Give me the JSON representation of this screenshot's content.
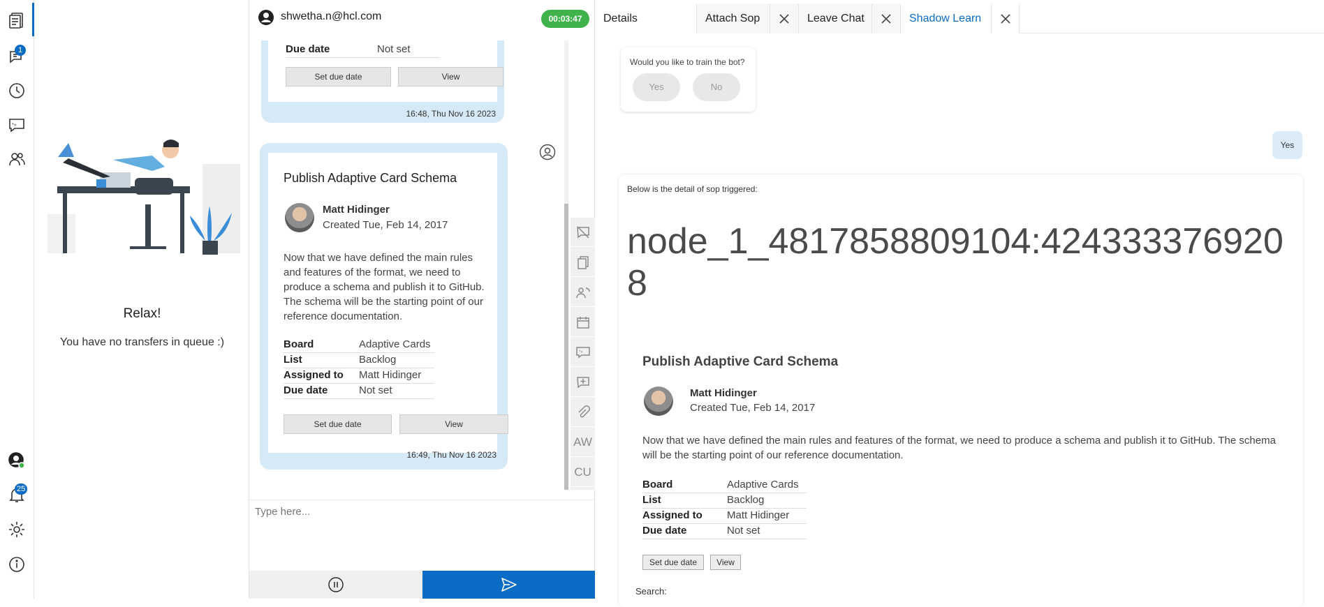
{
  "rail": {
    "icons": [
      "queue-icon",
      "chat-icon",
      "history-icon",
      "canned-response-icon",
      "contacts-icon"
    ],
    "chat_badge": "1",
    "notifications_badge": "25",
    "bottom_icons": [
      "user-status-icon",
      "bell-icon",
      "gear-icon",
      "info-icon"
    ],
    "accent": "#0b6cc5"
  },
  "queue": {
    "title": "Relax!",
    "subtitle": "You have no transfers in queue :)"
  },
  "chat": {
    "user": "shwetha.n@hcl.com",
    "timer": "00:03:47",
    "timer_color": "#3fb24b",
    "top_card": {
      "due_label": "Due date",
      "due_value": "Not set",
      "set_due_btn": "Set due date",
      "view_btn": "View",
      "timestamp": "16:48, Thu Nov 16 2023"
    },
    "card": {
      "title": "Publish Adaptive Card Schema",
      "author": "Matt Hidinger",
      "created": "Created Tue, Feb 14, 2017",
      "description": "Now that we have defined the main rules and features of the format, we need to produce a schema and publish it to GitHub. The schema will be the starting point of our reference documentation.",
      "facts": [
        {
          "k": "Board",
          "v": "Adaptive Cards"
        },
        {
          "k": "List",
          "v": "Backlog"
        },
        {
          "k": "Assigned to",
          "v": "Matt Hidinger"
        },
        {
          "k": "Due date",
          "v": "Not set"
        }
      ],
      "set_due_btn": "Set due date",
      "view_btn": "View",
      "timestamp": "16:49, Thu Nov 16 2023"
    },
    "tools": {
      "aw": "AW",
      "cu": "CU"
    },
    "input_placeholder": "Type here..."
  },
  "right": {
    "tabs": [
      "Details",
      "Attach Sop",
      "Leave Chat",
      "Shadow Learn"
    ],
    "train_question": "Would you like to train the bot?",
    "yes": "Yes",
    "no": "No",
    "user_reply": "Yes",
    "sop_intro": "Below is the detail of sop triggered:",
    "node_id": "node_1_4817858809104:4243333769208",
    "card": {
      "title": "Publish Adaptive Card Schema",
      "author": "Matt Hidinger",
      "created": "Created Tue, Feb 14, 2017",
      "description": "Now that we have defined the main rules and features of the format, we need to produce a schema and publish it to GitHub. The schema will be the starting point of our reference documentation.",
      "facts": [
        {
          "k": "Board",
          "v": "Adaptive Cards"
        },
        {
          "k": "List",
          "v": "Backlog"
        },
        {
          "k": "Assigned to",
          "v": "Matt Hidinger"
        },
        {
          "k": "Due date",
          "v": "Not set"
        }
      ],
      "set_due_btn": "Set due date",
      "view_btn": "View"
    },
    "search_label": "Search:"
  }
}
